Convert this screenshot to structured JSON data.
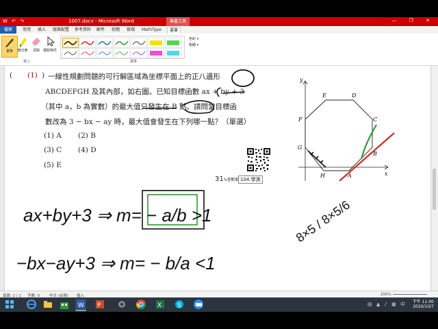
{
  "window": {
    "title": "1007.docx - Microsoft Word",
    "context_tab": "筆畫工具",
    "quick_access": "W ↶ ↷",
    "controls": "— ❐ ✕"
  },
  "ribbon": {
    "tabs": [
      "檔案",
      "常用",
      "插入",
      "版面配置",
      "參考資料",
      "郵件",
      "校閱",
      "檢視",
      "MathType",
      "畫筆"
    ],
    "active_tab": "畫筆",
    "buttons": {
      "pen": "畫筆",
      "highlighter": "螢光筆",
      "eraser": "清除",
      "select": "選取物件"
    },
    "options": {
      "color": "色彩 ▾",
      "thickness": "粗細 ▾"
    },
    "group_labels": {
      "write": "寫入",
      "pens": "畫筆"
    }
  },
  "document": {
    "paren_open": "(",
    "question_number": "(1)",
    "paren_close": ")",
    "lines": [
      "一線性規劃問題的可行解區域為坐標平面上的正八邊形",
      "ABCDEFGH 及其內部，如右圖。已知目標函數 ax + by + 3",
      "（其中 a，b 為實數）的最大值只發生在 B 點。請問當目標函",
      "數改為 3 − bx − ay 時，最大值會發生在下列哪一點？（單選）"
    ],
    "options": [
      [
        "(1) A",
        "(2) B"
      ],
      [
        "(3) C",
        "(4) D"
      ],
      [
        "(5) E"
      ]
    ],
    "answer_rate": "31",
    "answer_rate_unit": "%答對率",
    "source_badge": "104.學測",
    "figure": {
      "axis_x": "x",
      "axis_y": "y",
      "vertices": [
        "A",
        "B",
        "C",
        "D",
        "E",
        "F",
        "G",
        "H"
      ]
    },
    "handwriting": {
      "line1": "ax+by+3 ⇒ m= − a/b >1",
      "line2": "−bx−ay+3 ⇒ m= − b/a <1",
      "angles": "8×5 / 8×5/6"
    }
  },
  "statusbar": {
    "page": "頁面: 2 / 2",
    "words": "字數: 0",
    "lang": "中文 (台灣)",
    "mode": "插入",
    "zoom": "200%"
  },
  "taskbar": {
    "time": "下午 11:00",
    "date": "2020/10/7",
    "apps": [
      "start",
      "ie",
      "folder",
      "store",
      "word",
      "powerpoint",
      "tools",
      "chrome",
      "excel",
      "skype",
      "zoom"
    ]
  },
  "colors": {
    "titlebar": "#cc0000",
    "file_tab": "#1e5fb4",
    "ink_black": "#111111",
    "ink_red": "#e0251e",
    "ink_green": "#2e9a2e",
    "taskbar": "#2a3540"
  }
}
